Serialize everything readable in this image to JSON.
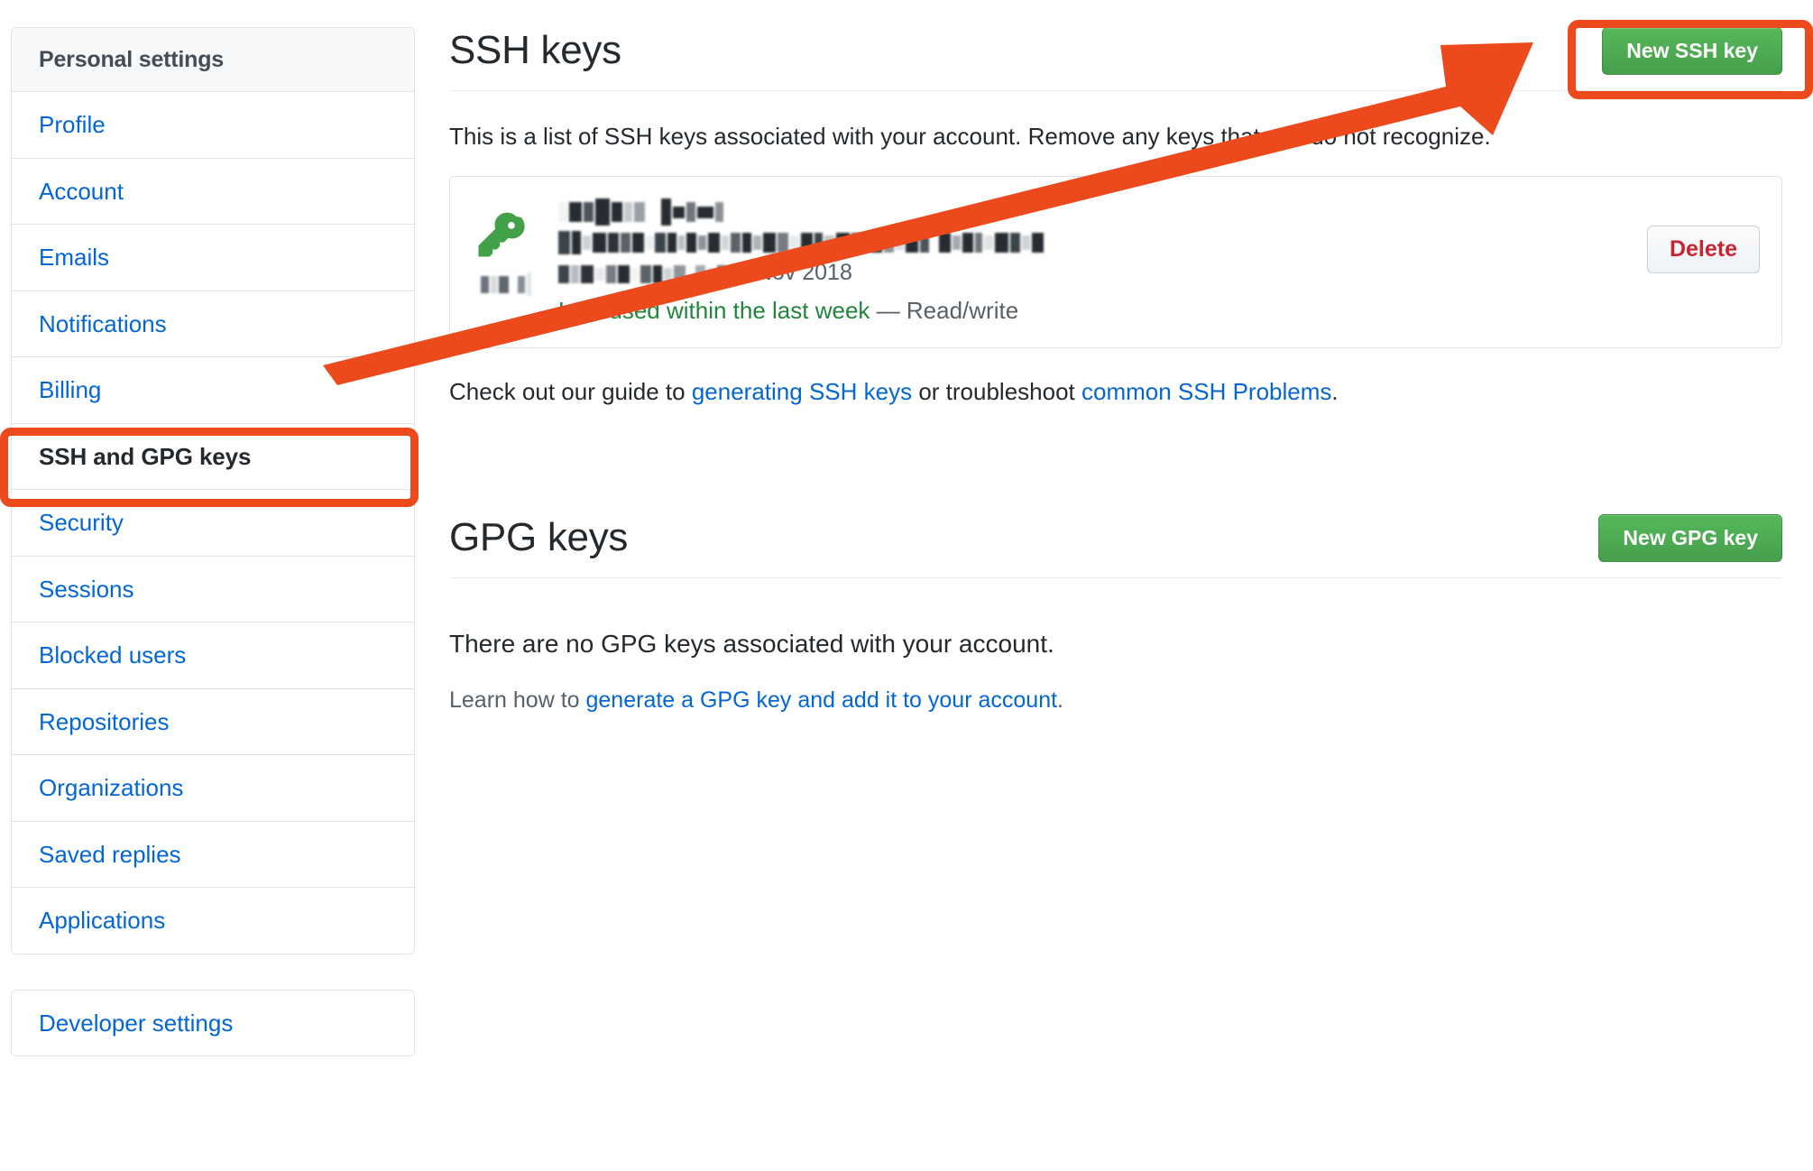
{
  "sidebar": {
    "header": "Personal settings",
    "items": [
      {
        "label": "Profile",
        "selected": false
      },
      {
        "label": "Account",
        "selected": false
      },
      {
        "label": "Emails",
        "selected": false
      },
      {
        "label": "Notifications",
        "selected": false
      },
      {
        "label": "Billing",
        "selected": false
      },
      {
        "label": "SSH and GPG keys",
        "selected": true
      },
      {
        "label": "Security",
        "selected": false
      },
      {
        "label": "Sessions",
        "selected": false
      },
      {
        "label": "Blocked users",
        "selected": false
      },
      {
        "label": "Repositories",
        "selected": false
      },
      {
        "label": "Organizations",
        "selected": false
      },
      {
        "label": "Saved replies",
        "selected": false
      },
      {
        "label": "Applications",
        "selected": false
      }
    ],
    "secondary_items": [
      {
        "label": "Developer settings"
      }
    ]
  },
  "ssh_section": {
    "title": "SSH keys",
    "new_key_button": "New SSH key",
    "description": "This is a list of SSH keys associated with your account. Remove any keys that you do not recognize.",
    "key_entry": {
      "icon": "key-icon",
      "title_redacted": true,
      "fingerprint_redacted": true,
      "date_prefix_redacted": true,
      "date": "3 Nov 2018",
      "last_used": "Last used within the last week",
      "separator": "—",
      "access": "Read/write",
      "delete_button": "Delete"
    },
    "guide": {
      "prefix": "Check out our guide to ",
      "link1": "generating SSH keys",
      "middle": " or troubleshoot ",
      "link2": "common SSH Problems",
      "suffix": "."
    }
  },
  "gpg_section": {
    "title": "GPG keys",
    "new_key_button": "New GPG key",
    "empty_message": "There are no GPG keys associated with your account.",
    "learn_prefix": "Learn how to ",
    "learn_link": "generate a GPG key and add it to your account",
    "learn_suffix": "."
  },
  "annotations": {
    "highlight_color": "#ec4a1c",
    "sidebar_highlight_target": "SSH and GPG keys",
    "button_highlight_target": "New SSH key",
    "arrow": "points from SSH and GPG keys sidebar item to New SSH key button"
  },
  "colors": {
    "link": "#0366d6",
    "green_button": "#4aa css",
    "green_button_hex": "#4fa856",
    "delete_red": "#cb2431",
    "success_green": "#22863a",
    "border": "#e1e4e8",
    "header_bg": "#f6f8fa"
  }
}
